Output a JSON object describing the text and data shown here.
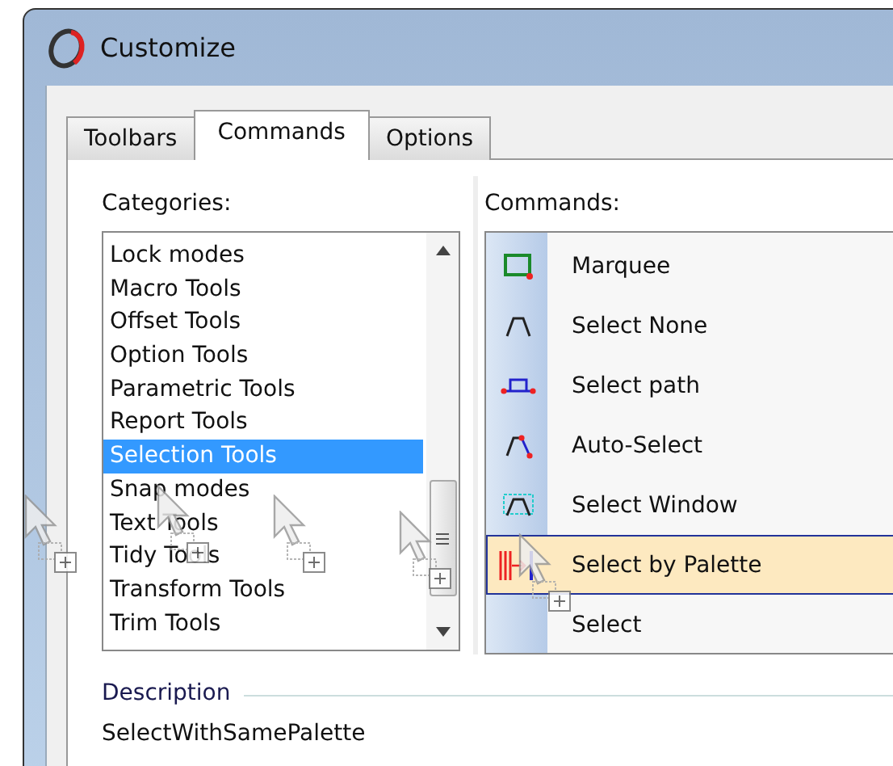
{
  "window": {
    "title": "Customize"
  },
  "tabs": [
    {
      "label": "Toolbars",
      "selected": false
    },
    {
      "label": "Commands",
      "selected": true
    },
    {
      "label": "Options",
      "selected": false
    }
  ],
  "categories": {
    "label": "Categories:",
    "items": [
      {
        "label": "Lock modes",
        "selected": false
      },
      {
        "label": "Macro Tools",
        "selected": false
      },
      {
        "label": "Offset Tools",
        "selected": false
      },
      {
        "label": "Option Tools",
        "selected": false
      },
      {
        "label": "Parametric Tools",
        "selected": false
      },
      {
        "label": "Report Tools",
        "selected": false
      },
      {
        "label": "Selection Tools",
        "selected": true
      },
      {
        "label": "Snap modes",
        "selected": false
      },
      {
        "label": "Text Tools",
        "selected": false
      },
      {
        "label": "Tidy Tools",
        "selected": false
      },
      {
        "label": "Transform Tools",
        "selected": false
      },
      {
        "label": "Trim Tools",
        "selected": false
      }
    ]
  },
  "commands": {
    "label": "Commands:",
    "items": [
      {
        "label": "Marquee",
        "kind": "marquee",
        "selected": false
      },
      {
        "label": "Select None",
        "kind": "curve",
        "selected": false
      },
      {
        "label": "Select path",
        "kind": "path",
        "selected": false
      },
      {
        "label": "Auto-Select",
        "kind": "auto",
        "selected": false
      },
      {
        "label": "Select Window",
        "kind": "window",
        "selected": false
      },
      {
        "label": "Select by Palette",
        "kind": "palette",
        "selected": true
      },
      {
        "label": "Select",
        "kind": "none",
        "selected": false
      }
    ]
  },
  "description": {
    "label": "Description",
    "text": "SelectWithSamePalette"
  }
}
